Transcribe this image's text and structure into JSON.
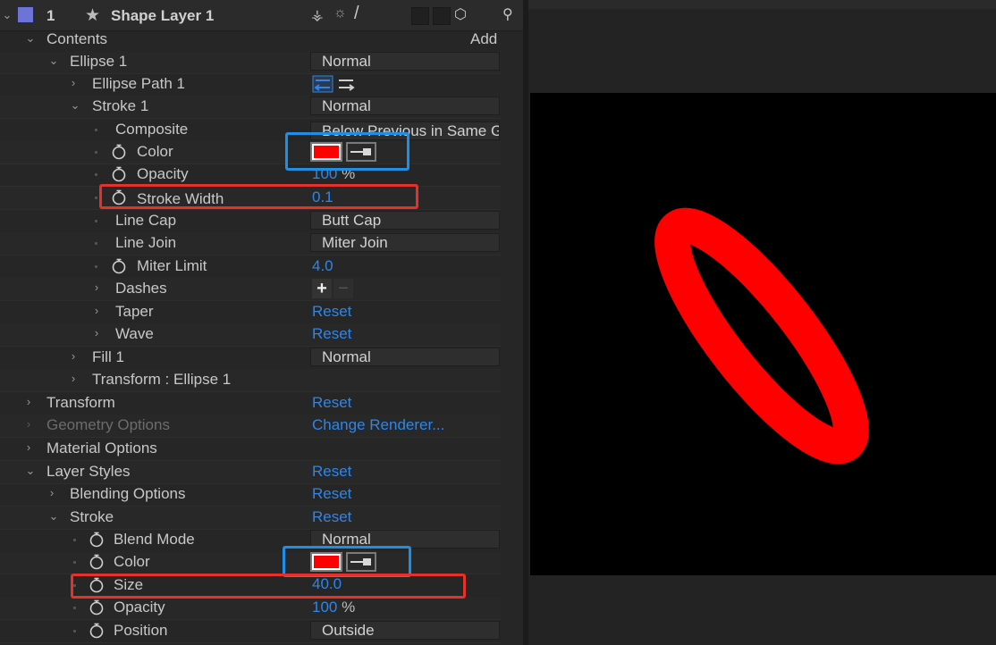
{
  "layer": {
    "number": "1",
    "name": "Shape Layer 1",
    "label_color": "#6d74d8"
  },
  "contents": {
    "label": "Contents",
    "add_label": "Add"
  },
  "rows": {
    "ellipse1": {
      "label": "Ellipse 1",
      "value": "Normal"
    },
    "ellipse_path": {
      "label": "Ellipse Path 1"
    },
    "stroke1": {
      "label": "Stroke 1",
      "value": "Normal"
    },
    "composite": {
      "label": "Composite",
      "value": "Below Previous in Same Gr"
    },
    "color1": {
      "label": "Color",
      "color": "#ff0000"
    },
    "opacity1": {
      "label": "Opacity",
      "value": "100",
      "unit": "%"
    },
    "stroke_width": {
      "label": "Stroke Width",
      "value": "0.1"
    },
    "line_cap": {
      "label": "Line Cap",
      "value": "Butt Cap"
    },
    "line_join": {
      "label": "Line Join",
      "value": "Miter Join"
    },
    "miter_limit": {
      "label": "Miter Limit",
      "value": "4.0"
    },
    "dashes": {
      "label": "Dashes",
      "add": "+",
      "remove": "−"
    },
    "taper": {
      "label": "Taper",
      "value": "Reset"
    },
    "wave": {
      "label": "Wave",
      "value": "Reset"
    },
    "fill1": {
      "label": "Fill 1",
      "value": "Normal"
    },
    "transform_ellipse": {
      "label": "Transform : Ellipse 1"
    },
    "transform": {
      "label": "Transform",
      "value": "Reset"
    },
    "geometry": {
      "label": "Geometry Options",
      "value": "Change Renderer..."
    },
    "material": {
      "label": "Material Options"
    },
    "layer_styles": {
      "label": "Layer Styles",
      "value": "Reset"
    },
    "blending": {
      "label": "Blending Options",
      "value": "Reset"
    },
    "stroke_style": {
      "label": "Stroke",
      "value": "Reset"
    },
    "blend_mode": {
      "label": "Blend Mode",
      "value": "Normal"
    },
    "color2": {
      "label": "Color",
      "color": "#ff0000"
    },
    "size": {
      "label": "Size",
      "value": "40.0"
    },
    "opacity2": {
      "label": "Opacity",
      "value": "100",
      "unit": "%"
    },
    "position": {
      "label": "Position",
      "value": "Outside"
    }
  },
  "colors": {
    "accent_blue": "#2f86e8",
    "highlight_red": "#e8302a",
    "highlight_blue": "#1e8fe8",
    "shape_stroke": "#ff0000"
  }
}
